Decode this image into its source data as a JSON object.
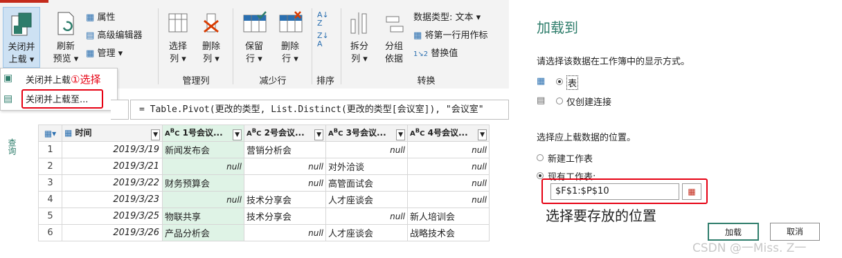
{
  "ribbon": {
    "close_load": "关闭并\n上载",
    "close_load_l1": "关闭并",
    "close_load_l2": "上载",
    "refresh_l1": "刷新",
    "refresh_l2": "预览",
    "properties": "属性",
    "advanced_editor": "高级编辑器",
    "manage": "管理",
    "choose_cols_l1": "选择",
    "choose_cols_l2": "列",
    "remove_cols_l1": "删除",
    "remove_cols_l2": "列",
    "keep_rows_l1": "保留",
    "keep_rows_l2": "行",
    "remove_rows_l1": "删除",
    "remove_rows_l2": "行",
    "split_l1": "拆分",
    "split_l2": "列",
    "group_l1": "分组",
    "group_l2": "依据",
    "data_type": "数据类型: 文本",
    "first_row_header": "将第一行用作标",
    "replace_values": "替换值",
    "group_manage_cols": "管理列",
    "group_reduce_rows": "减少行",
    "group_sort": "排序",
    "group_transform": "转换"
  },
  "dropdown": {
    "item1": "关闭并上载",
    "item1_note": "①选择",
    "item2": "关闭并上载至..."
  },
  "formula": "= Table.Pivot(更改的类型, List.Distinct(更改的类型[会议室]), \"会议室\"",
  "side_label": "查询",
  "table": {
    "headers": [
      "时间",
      "1号会议...",
      "2号会议...",
      "3号会议...",
      "4号会议..."
    ],
    "rows": [
      [
        "1",
        "2019/3/19",
        "新闻发布会",
        "营销分析会",
        "null",
        "null"
      ],
      [
        "2",
        "2019/3/21",
        "null",
        "null",
        "对外洽谈",
        "null"
      ],
      [
        "3",
        "2019/3/22",
        "财务预算会",
        "null",
        "高管面试会",
        "null"
      ],
      [
        "4",
        "2019/3/23",
        "null",
        "技术分享会",
        "人才座谈会",
        "null"
      ],
      [
        "5",
        "2019/3/25",
        "物联共享",
        "技术分享会",
        "null",
        "新人培训会"
      ],
      [
        "6",
        "2019/3/26",
        "产品分析会",
        "null",
        "人才座谈会",
        "战略技术会"
      ]
    ]
  },
  "panel": {
    "title": "加载到",
    "prompt1": "请选择该数据在工作簿中的显示方式。",
    "opt_table": "表",
    "opt_connection": "仅创建连接",
    "prompt2": "选择应上载数据的位置。",
    "opt_new_sheet": "新建工作表",
    "opt_existing_sheet": "现有工作表:",
    "range_value": "$F$1:$P$10",
    "annotation": "选择要存放的位置",
    "load_button": "加载",
    "cancel_button": "取消",
    "watermark": "CSDN @一Miss. Z一"
  },
  "colors": {
    "accent": "#2e7d6b",
    "annotation_red": "#e60012",
    "selected_col": "#dff3e6"
  }
}
